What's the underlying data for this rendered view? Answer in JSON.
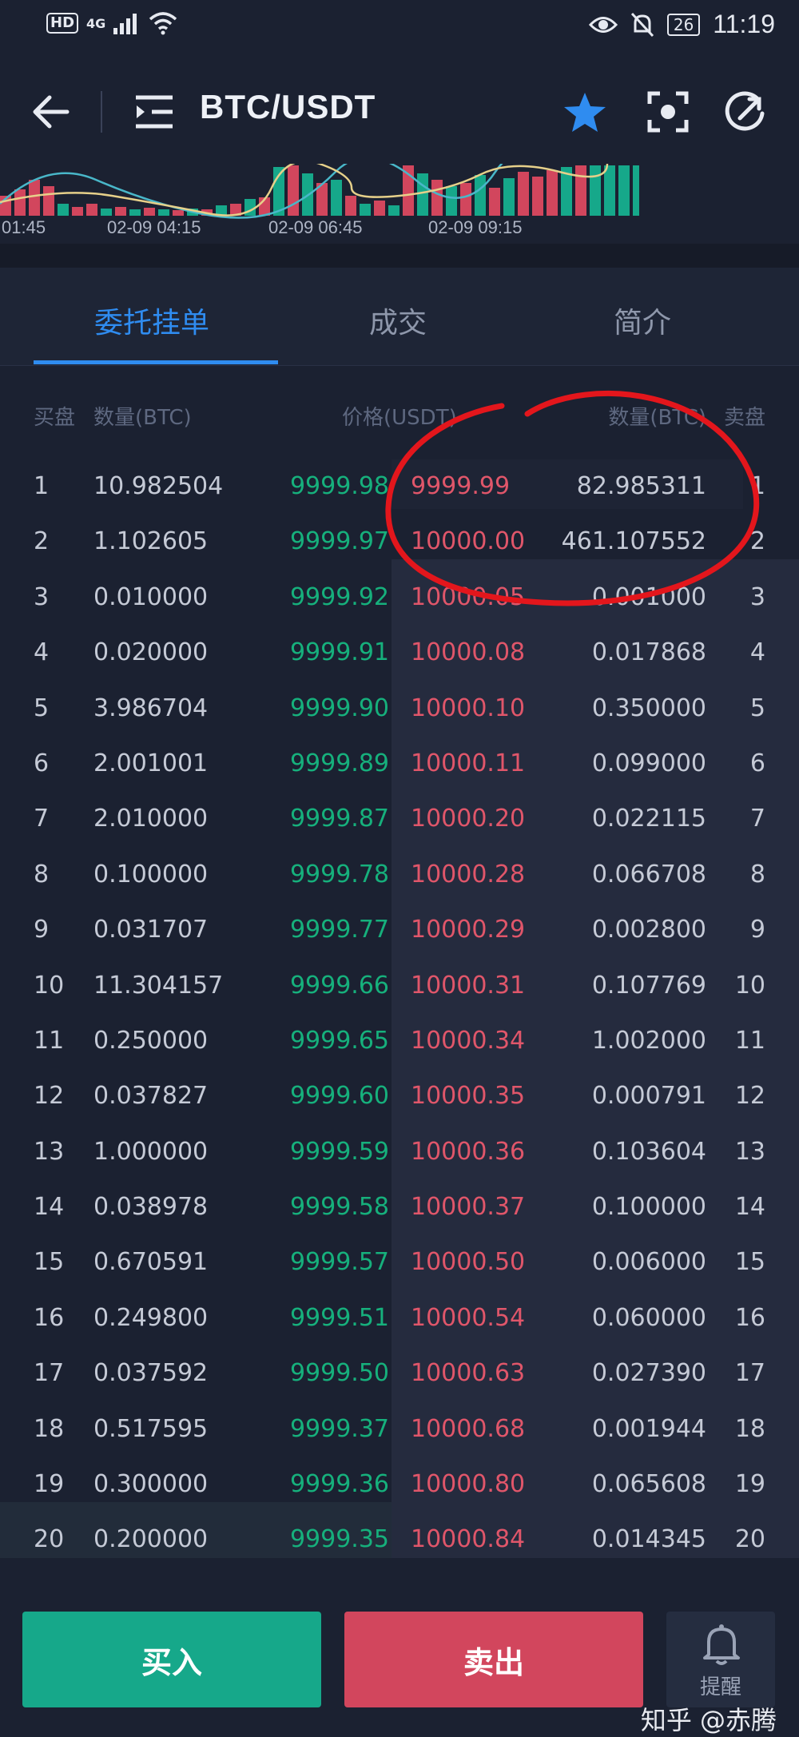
{
  "status_bar": {
    "network_hd": "HD",
    "network_type": "4G",
    "battery": "26",
    "time": "11:19"
  },
  "header": {
    "title": "BTC/USDT"
  },
  "mini_chart": {
    "time_labels": [
      "01:45",
      "02-09 04:15",
      "02-09 06:45",
      "02-09 09:15"
    ]
  },
  "tabs": [
    {
      "label": "委托挂单",
      "active": true
    },
    {
      "label": "成交",
      "active": false
    },
    {
      "label": "简介",
      "active": false
    }
  ],
  "columns": {
    "bid_side": "买盘",
    "bid_qty": "数量(BTC)",
    "price": "价格(USDT)",
    "ask_qty": "数量(BTC)",
    "ask_side": "卖盘"
  },
  "rows": [
    {
      "idx": "1",
      "bid_qty": "10.982504",
      "bid_price": "9999.98",
      "ask_price": "9999.99",
      "ask_qty": "82.985311",
      "ridx": "1"
    },
    {
      "idx": "2",
      "bid_qty": "1.102605",
      "bid_price": "9999.97",
      "ask_price": "10000.00",
      "ask_qty": "461.107552",
      "ridx": "2"
    },
    {
      "idx": "3",
      "bid_qty": "0.010000",
      "bid_price": "9999.92",
      "ask_price": "10000.05",
      "ask_qty": "0.001000",
      "ridx": "3"
    },
    {
      "idx": "4",
      "bid_qty": "0.020000",
      "bid_price": "9999.91",
      "ask_price": "10000.08",
      "ask_qty": "0.017868",
      "ridx": "4"
    },
    {
      "idx": "5",
      "bid_qty": "3.986704",
      "bid_price": "9999.90",
      "ask_price": "10000.10",
      "ask_qty": "0.350000",
      "ridx": "5"
    },
    {
      "idx": "6",
      "bid_qty": "2.001001",
      "bid_price": "9999.89",
      "ask_price": "10000.11",
      "ask_qty": "0.099000",
      "ridx": "6"
    },
    {
      "idx": "7",
      "bid_qty": "2.010000",
      "bid_price": "9999.87",
      "ask_price": "10000.20",
      "ask_qty": "0.022115",
      "ridx": "7"
    },
    {
      "idx": "8",
      "bid_qty": "0.100000",
      "bid_price": "9999.78",
      "ask_price": "10000.28",
      "ask_qty": "0.066708",
      "ridx": "8"
    },
    {
      "idx": "9",
      "bid_qty": "0.031707",
      "bid_price": "9999.77",
      "ask_price": "10000.29",
      "ask_qty": "0.002800",
      "ridx": "9"
    },
    {
      "idx": "10",
      "bid_qty": "11.304157",
      "bid_price": "9999.66",
      "ask_price": "10000.31",
      "ask_qty": "0.107769",
      "ridx": "10"
    },
    {
      "idx": "11",
      "bid_qty": "0.250000",
      "bid_price": "9999.65",
      "ask_price": "10000.34",
      "ask_qty": "1.002000",
      "ridx": "11"
    },
    {
      "idx": "12",
      "bid_qty": "0.037827",
      "bid_price": "9999.60",
      "ask_price": "10000.35",
      "ask_qty": "0.000791",
      "ridx": "12"
    },
    {
      "idx": "13",
      "bid_qty": "1.000000",
      "bid_price": "9999.59",
      "ask_price": "10000.36",
      "ask_qty": "0.103604",
      "ridx": "13"
    },
    {
      "idx": "14",
      "bid_qty": "0.038978",
      "bid_price": "9999.58",
      "ask_price": "10000.37",
      "ask_qty": "0.100000",
      "ridx": "14"
    },
    {
      "idx": "15",
      "bid_qty": "0.670591",
      "bid_price": "9999.57",
      "ask_price": "10000.50",
      "ask_qty": "0.006000",
      "ridx": "15"
    },
    {
      "idx": "16",
      "bid_qty": "0.249800",
      "bid_price": "9999.51",
      "ask_price": "10000.54",
      "ask_qty": "0.060000",
      "ridx": "16"
    },
    {
      "idx": "17",
      "bid_qty": "0.037592",
      "bid_price": "9999.50",
      "ask_price": "10000.63",
      "ask_qty": "0.027390",
      "ridx": "17"
    },
    {
      "idx": "18",
      "bid_qty": "0.517595",
      "bid_price": "9999.37",
      "ask_price": "10000.68",
      "ask_qty": "0.001944",
      "ridx": "18"
    },
    {
      "idx": "19",
      "bid_qty": "0.300000",
      "bid_price": "9999.36",
      "ask_price": "10000.80",
      "ask_qty": "0.065608",
      "ridx": "19"
    },
    {
      "idx": "20",
      "bid_qty": "0.200000",
      "bid_price": "9999.35",
      "ask_price": "10000.84",
      "ask_qty": "0.014345",
      "ridx": "20"
    }
  ],
  "actions": {
    "buy": "买入",
    "sell": "卖出",
    "alert": "提醒"
  },
  "watermark": "知乎 @赤腾",
  "colors": {
    "background": "#1b2131",
    "accent": "#2f8cf0",
    "bid_green": "#16b07c",
    "ask_red": "#e0566a",
    "buy_button": "#16a88a",
    "sell_button": "#d2465d",
    "annotation": "#e3161c"
  }
}
